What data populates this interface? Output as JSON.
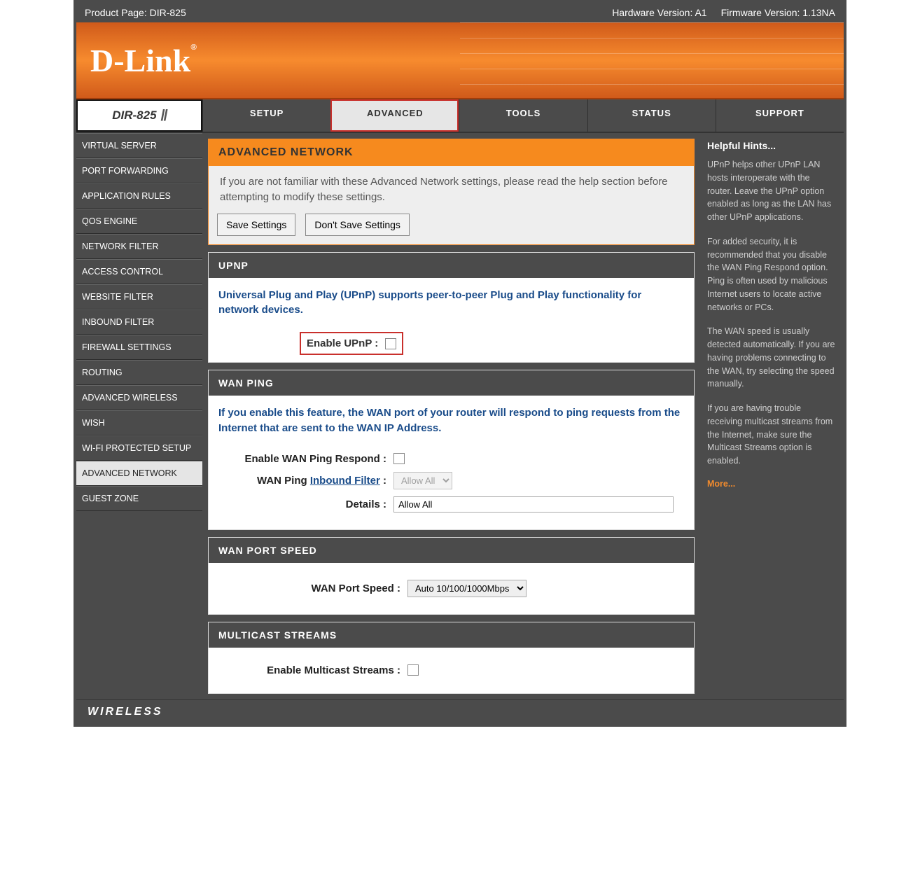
{
  "topbar": {
    "product_page_label": "Product Page: DIR-825",
    "hw_version": "Hardware Version: A1",
    "fw_version": "Firmware Version: 1.13NA"
  },
  "logo": "D-Link",
  "nav": {
    "model": "DIR-825",
    "tabs": [
      "SETUP",
      "ADVANCED",
      "TOOLS",
      "STATUS",
      "SUPPORT"
    ]
  },
  "sidebar": [
    "VIRTUAL SERVER",
    "PORT FORWARDING",
    "APPLICATION RULES",
    "QOS ENGINE",
    "NETWORK FILTER",
    "ACCESS CONTROL",
    "WEBSITE FILTER",
    "INBOUND FILTER",
    "FIREWALL SETTINGS",
    "ROUTING",
    "ADVANCED WIRELESS",
    "WISH",
    "WI-FI PROTECTED SETUP",
    "ADVANCED NETWORK",
    "GUEST ZONE"
  ],
  "intro": {
    "heading": "ADVANCED NETWORK",
    "text": "If you are not familiar with these Advanced Network settings, please read the help section before attempting to modify these settings.",
    "save_btn": "Save Settings",
    "dont_save_btn": "Don't Save Settings"
  },
  "upnp": {
    "heading": "UPNP",
    "desc": "Universal Plug and Play (UPnP) supports peer-to-peer Plug and Play functionality for network devices.",
    "enable_label": "Enable UPnP :"
  },
  "wanping": {
    "heading": "WAN PING",
    "desc": "If you enable this feature, the WAN port of your router will respond to ping requests from the Internet that are sent to the WAN IP Address.",
    "enable_label": "Enable WAN Ping Respond :",
    "filter_label": "WAN Ping ",
    "filter_link": "Inbound Filter",
    "filter_colon": " :",
    "filter_value": "Allow All",
    "details_label": "Details :",
    "details_value": "Allow All"
  },
  "wanspeed": {
    "heading": "WAN PORT SPEED",
    "label": "WAN Port Speed :",
    "value": "Auto 10/100/1000Mbps"
  },
  "multicast": {
    "heading": "MULTICAST STREAMS",
    "label": "Enable Multicast Streams :"
  },
  "hints": {
    "heading": "Helpful Hints...",
    "p1": "UPnP helps other UPnP LAN hosts interoperate with the router. Leave the UPnP option enabled as long as the LAN has other UPnP applications.",
    "p2": "For added security, it is recommended that you disable the WAN Ping Respond option. Ping is often used by malicious Internet users to locate active networks or PCs.",
    "p3": "The WAN speed is usually detected automatically. If you are having problems connecting to the WAN, try selecting the speed manually.",
    "p4": "If you are having trouble receiving multicast streams from the Internet, make sure the Multicast Streams option is enabled.",
    "more": "More..."
  },
  "footer": "WIRELESS"
}
